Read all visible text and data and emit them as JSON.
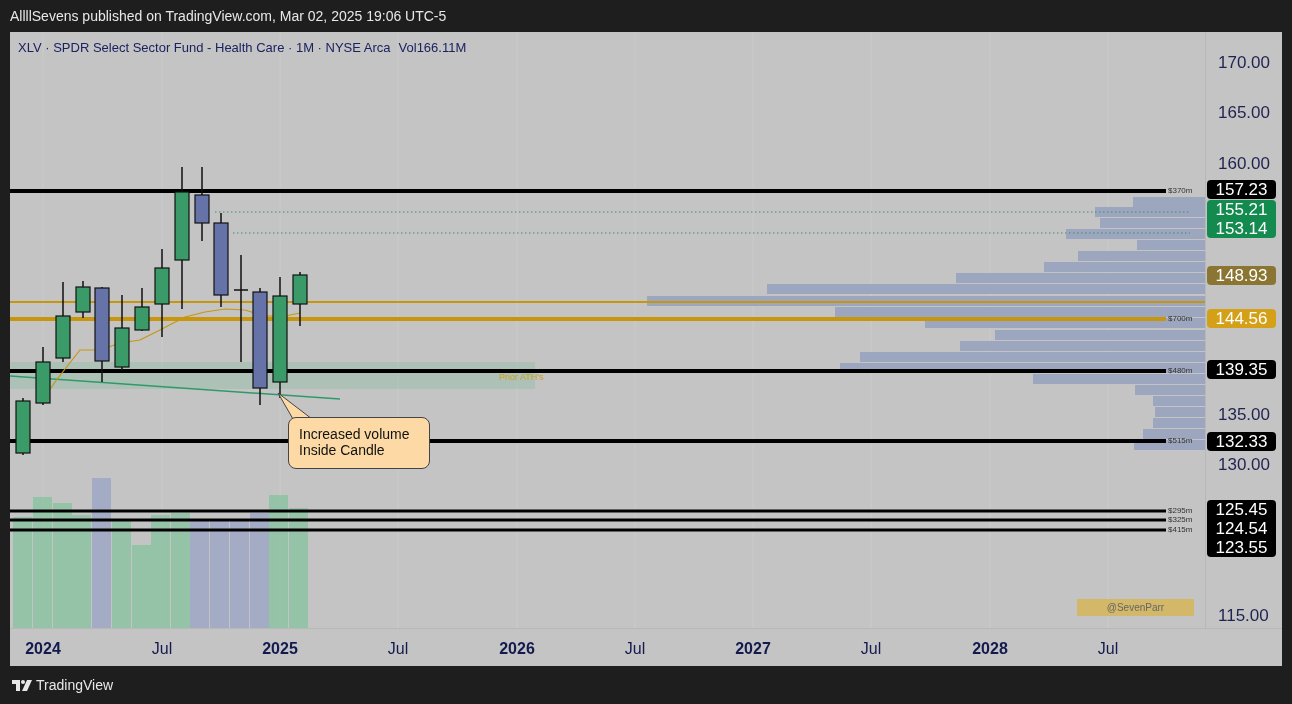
{
  "header": {
    "text": "AllllSevens published on TradingView.com, Mar 02, 2025 19:06 UTC-5"
  },
  "legend": {
    "symbol": "XLV · SPDR Select Sector Fund - Health Care · 1M · NYSE Arca",
    "volume": "Vol166.11M"
  },
  "levels": [
    {
      "label": "$370m",
      "color": "#000000"
    },
    {
      "label": "$700m",
      "color": "#c8960c"
    },
    {
      "label": "$480m",
      "color": "#000000"
    },
    {
      "label": "$515m",
      "color": "#000000"
    },
    {
      "label": "$295m",
      "color": "#000000"
    },
    {
      "label": "$325m",
      "color": "#000000"
    },
    {
      "label": "$415m",
      "color": "#000000"
    }
  ],
  "zone": {
    "label": "Prior ATH's"
  },
  "callout": {
    "lines": [
      "Increased volume",
      "Inside Candle"
    ]
  },
  "signature": {
    "text": "@SevenParr"
  },
  "price_axis": {
    "ticks": [
      "170.00",
      "165.00",
      "160.00",
      "135.00",
      "130.00",
      "115.00"
    ],
    "tags": [
      {
        "labels": [
          "157.23"
        ],
        "color": "#000000"
      },
      {
        "labels": [
          "155.21",
          "153.14"
        ],
        "color": "#138a4e"
      },
      {
        "labels": [
          "148.93"
        ],
        "color": "#8a7532"
      },
      {
        "labels": [
          "144.56"
        ],
        "color": "#d4a017"
      },
      {
        "labels": [
          "139.35"
        ],
        "color": "#000000"
      },
      {
        "labels": [
          "132.33"
        ],
        "color": "#000000"
      },
      {
        "labels": [
          "125.45",
          "124.54",
          "123.55"
        ],
        "color": "#000000"
      }
    ]
  },
  "time_axis": [
    {
      "label": "2024",
      "kind": "year"
    },
    {
      "label": "Jul",
      "kind": "month"
    },
    {
      "label": "2025",
      "kind": "year"
    },
    {
      "label": "Jul",
      "kind": "month"
    },
    {
      "label": "2026",
      "kind": "year"
    },
    {
      "label": "Jul",
      "kind": "month"
    },
    {
      "label": "2027",
      "kind": "year"
    },
    {
      "label": "Jul",
      "kind": "month"
    },
    {
      "label": "2028",
      "kind": "year"
    },
    {
      "label": "Jul",
      "kind": "month"
    }
  ],
  "footer": {
    "brand": "TradingView"
  }
}
